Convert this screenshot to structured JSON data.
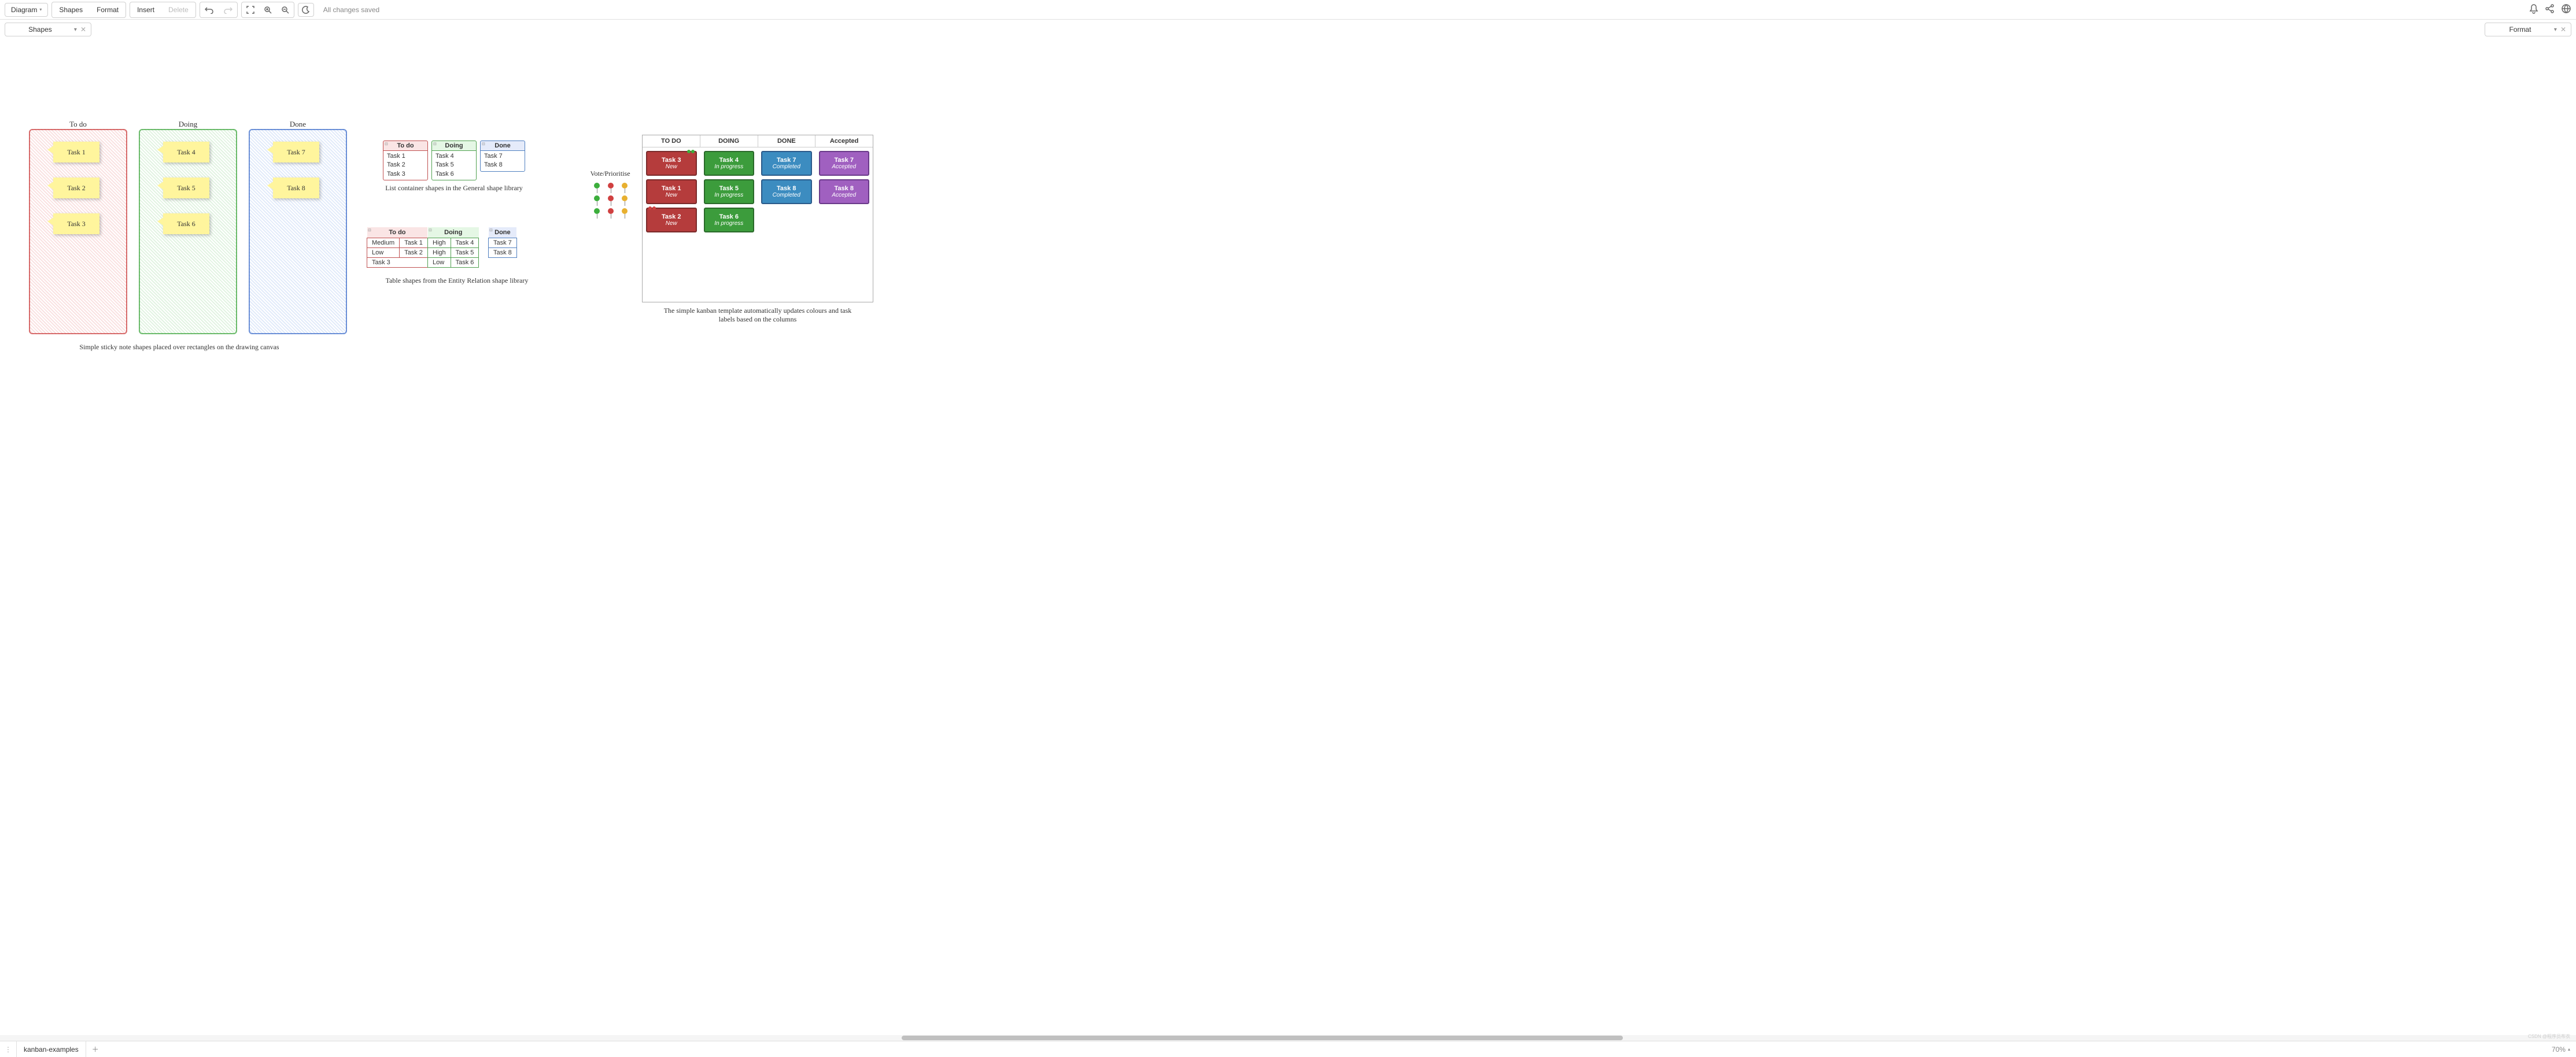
{
  "toolbar": {
    "diagram": "Diagram",
    "shapes": "Shapes",
    "format": "Format",
    "insert": "Insert",
    "delete": "Delete",
    "status": "All changes saved"
  },
  "panels": {
    "left": "Shapes",
    "right": "Format"
  },
  "sticky_section": {
    "columns": [
      {
        "title": "To do",
        "color": "red",
        "tasks": [
          "Task 1",
          "Task 2",
          "Task 3"
        ]
      },
      {
        "title": "Doing",
        "color": "green",
        "tasks": [
          "Task 4",
          "Task 5",
          "Task 6"
        ]
      },
      {
        "title": "Done",
        "color": "blue",
        "tasks": [
          "Task 7",
          "Task 8"
        ]
      }
    ],
    "caption": "Simple sticky note shapes placed over rectangles on the drawing canvas"
  },
  "list_section": {
    "columns": [
      {
        "title": "To do",
        "color": "red",
        "items": [
          "Task 1",
          "Task 2",
          "Task 3"
        ]
      },
      {
        "title": "Doing",
        "color": "green",
        "items": [
          "Task 4",
          "Task 5",
          "Task 6"
        ]
      },
      {
        "title": "Done",
        "color": "blue",
        "items": [
          "Task 7",
          "Task 8"
        ]
      }
    ],
    "caption": "List container shapes in the General shape library"
  },
  "table_section": {
    "columns": [
      {
        "title": "To do",
        "color": "red",
        "rows": [
          [
            "Medium",
            "Task 1"
          ],
          [
            "Low",
            "Task 2"
          ],
          [
            "",
            "Task 3"
          ]
        ]
      },
      {
        "title": "Doing",
        "color": "green",
        "rows": [
          [
            "High",
            "Task 4"
          ],
          [
            "High",
            "Task 5"
          ],
          [
            "Low",
            "Task 6"
          ]
        ]
      },
      {
        "title": "Done",
        "color": "blue",
        "rows": [
          [
            "",
            "Task 7"
          ],
          [
            "",
            "Task 8"
          ]
        ]
      }
    ],
    "caption": "Table shapes from the Entity Relation shape library"
  },
  "vote_label": "Vote/Prioritise",
  "pin_colors_row1": [
    "#3cae3c",
    "#d04040",
    "#e8b030"
  ],
  "pin_colors_row2": [
    "#3cae3c",
    "#d04040",
    "#e8b030"
  ],
  "pin_colors_row3": [
    "#3cae3c",
    "#d04040",
    "#e8b030"
  ],
  "kanban_template": {
    "headers": [
      "TO DO",
      "DOING",
      "DONE",
      "Accepted"
    ],
    "cols": [
      [
        {
          "t": "Task 3",
          "s": "New",
          "c": "red",
          "pins": [
            "#3cae3c",
            "#3cae3c"
          ]
        },
        {
          "t": "Task 1",
          "s": "New",
          "c": "red"
        },
        {
          "t": "Task 2",
          "s": "New",
          "c": "red",
          "pins_left": [
            "#d04040",
            "#d04040"
          ]
        }
      ],
      [
        {
          "t": "Task 4",
          "s": "In progress",
          "c": "green"
        },
        {
          "t": "Task 5",
          "s": "In progress",
          "c": "green"
        },
        {
          "t": "Task 6",
          "s": "In progress",
          "c": "green"
        }
      ],
      [
        {
          "t": "Task 7",
          "s": "Completed",
          "c": "blue"
        },
        {
          "t": "Task 8",
          "s": "Completed",
          "c": "blue"
        }
      ],
      [
        {
          "t": "Task 7",
          "s": "Accepted",
          "c": "purple"
        },
        {
          "t": "Task 8",
          "s": "Accepted",
          "c": "purple"
        }
      ]
    ],
    "caption": "The simple kanban template automatically updates colours and task labels based on the columns"
  },
  "tabs": {
    "name": "kanban-examples"
  },
  "zoom": "70%",
  "watermark": "CSDN @程序员布衣"
}
